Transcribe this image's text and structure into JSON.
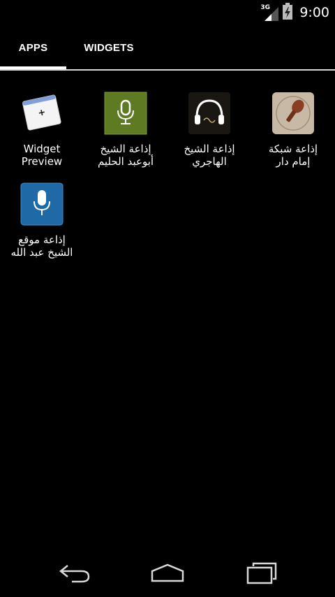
{
  "status_bar": {
    "network_type": "3G",
    "time": "9:00"
  },
  "tabs": [
    {
      "label": "APPS",
      "selected": true
    },
    {
      "label": "WIDGETS",
      "selected": false
    }
  ],
  "apps": [
    {
      "name": "Widget Preview",
      "line1": "Widget",
      "line2": "Preview",
      "icon": "widget-preview-icon"
    },
    {
      "name": "إذاعة الشيخ أبوعبد الحليم",
      "line1": "إذاعة الشيخ",
      "line2": "أبوعبد الحليم",
      "icon": "microphone-green-icon"
    },
    {
      "name": "إذاعة الشيخ الهاجري",
      "line1": "إذاعة الشيخ",
      "line2": "الهاجري",
      "icon": "headphones-icon"
    },
    {
      "name": "إذاعة شبكة إمام دار",
      "line1": "إذاعة شبكة",
      "line2": "إمام دار",
      "icon": "microphone-brown-icon"
    },
    {
      "name": "إذاعة موقع الشيخ عبد الله",
      "line1": "إذاعة موقع",
      "line2": "الشيخ عبد الله",
      "icon": "microphone-blue-icon"
    }
  ],
  "nav": {
    "back": "back-icon",
    "home": "home-icon",
    "recents": "recents-icon"
  },
  "colors": {
    "background": "#000000",
    "tab_indicator": "#ffffff"
  }
}
